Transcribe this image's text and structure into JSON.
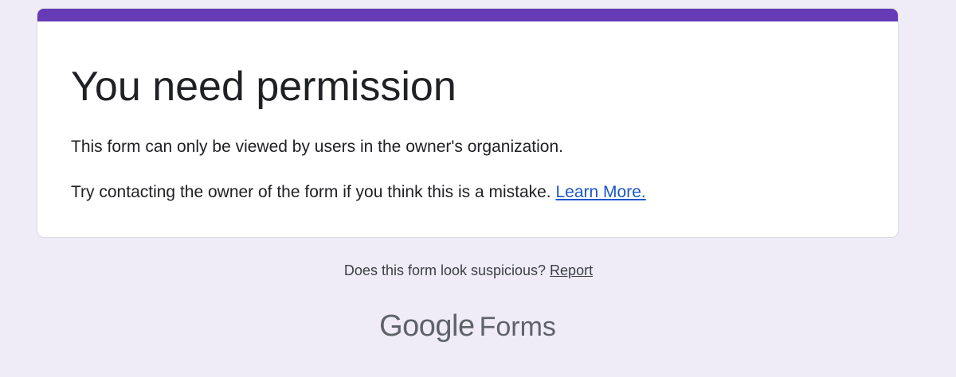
{
  "card": {
    "title": "You need permission",
    "message": "This form can only be viewed by users in the owner's organization.",
    "hint": "Try contacting the owner of the form if you think this is a mistake.",
    "learn_more_label": "Learn More."
  },
  "footer": {
    "suspicious_text": "Does this form look suspicious?",
    "report_label": "Report"
  },
  "brand": {
    "google": "Google",
    "product": "Forms"
  },
  "colors": {
    "page_background": "#efebf7",
    "accent": "#673ab7",
    "link": "#1a57c9",
    "text": "#202124"
  }
}
